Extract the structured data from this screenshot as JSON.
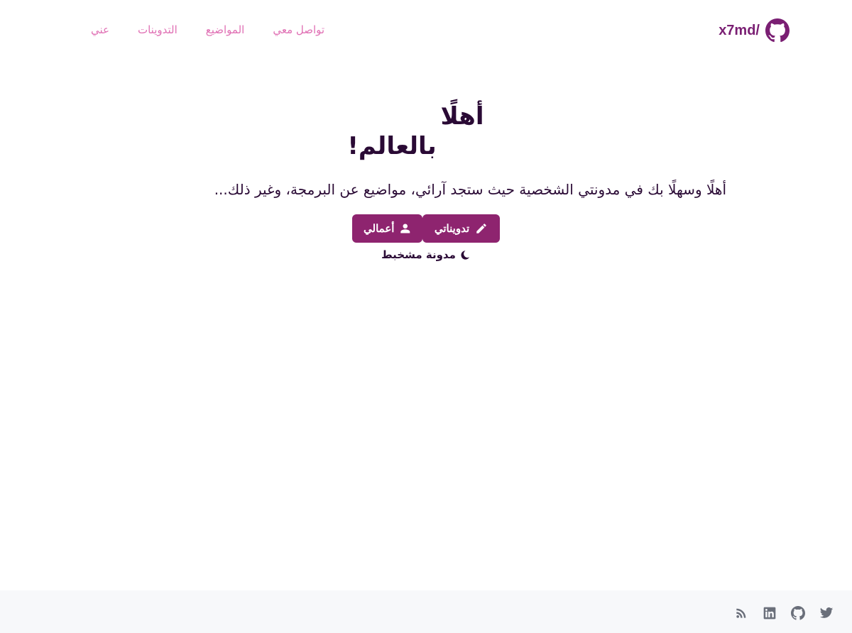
{
  "header": {
    "brand": "x7md/",
    "nav": {
      "about": "عني",
      "posts": "التدوينات",
      "topics": "المواضيع",
      "contact": "تواصل معي"
    }
  },
  "hero": {
    "title_line1": "أهلًا",
    "title_line2": "بالعالم!",
    "description": "أهلًا وسهلًا بك في مدونتي الشخصية حيث ستجد آرائي، مواضيع عن البرمجة، وغير ذلك...",
    "projects_button": "أعمالي",
    "posts_button": "تدويناتي",
    "theme_toggle": "مدونة مشخبط"
  },
  "footer": {
    "icons": [
      "twitter-icon",
      "github-icon",
      "linkedin-icon",
      "rss-icon"
    ]
  },
  "colors": {
    "brand": "#7a1f73",
    "nav_link": "#e070b4",
    "button": "#8e246f",
    "text": "#2a0a35",
    "footer_bg": "#f7f8fa",
    "footer_icon": "#6a6f7a"
  }
}
